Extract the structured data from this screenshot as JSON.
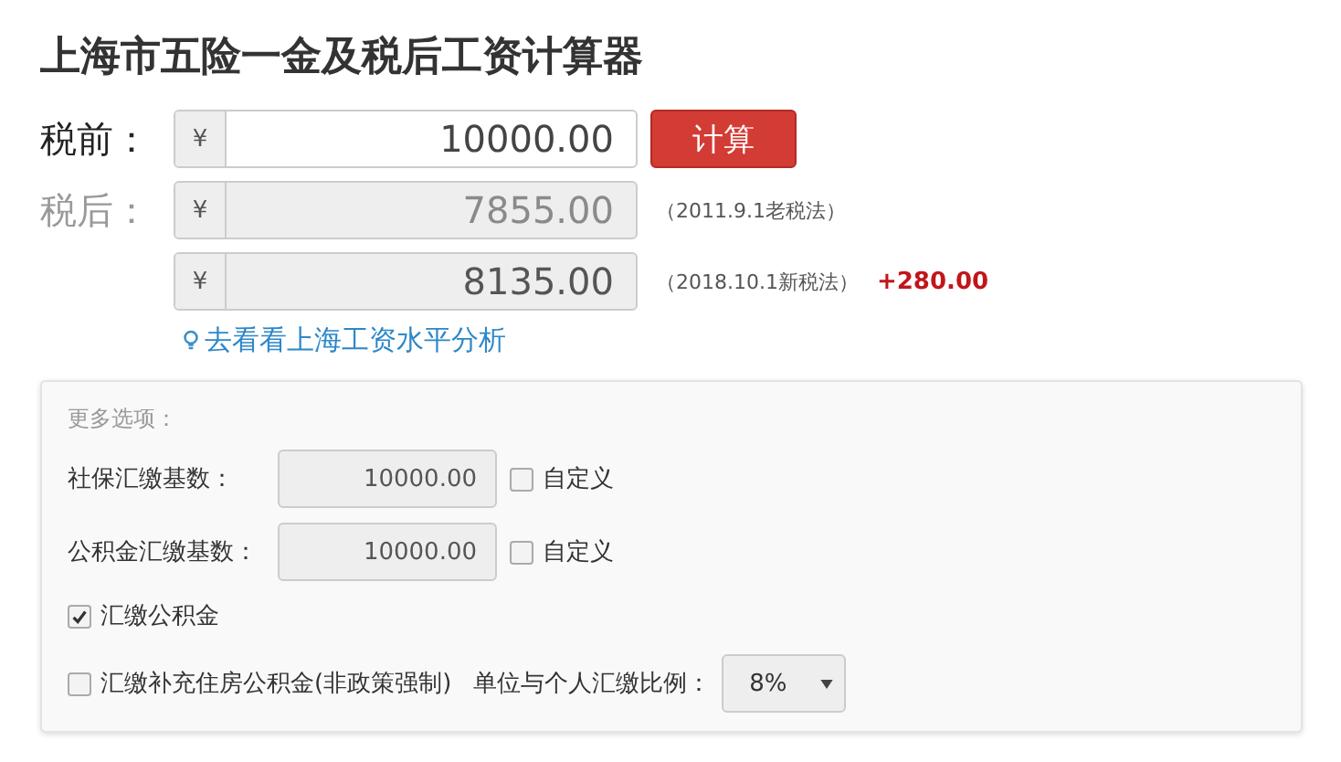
{
  "title": "上海市五险一金及税后工资计算器",
  "pretax": {
    "label": "税前：",
    "currency": "¥",
    "value": "10000.00"
  },
  "calc_button": "计算",
  "results_label": "税后：",
  "results": [
    {
      "currency": "¥",
      "value": "7855.00",
      "note": "（2011.9.1老税法）"
    },
    {
      "currency": "¥",
      "value": "8135.00",
      "note": "（2018.10.1新税法）",
      "diff": "+280.00"
    }
  ],
  "link": "去看看上海工资水平分析",
  "options": {
    "heading": "更多选项：",
    "bases": [
      {
        "label": "社保汇缴基数：",
        "value": "10000.00",
        "custom_label": "自定义",
        "checked": false
      },
      {
        "label": "公积金汇缴基数：",
        "value": "10000.00",
        "custom_label": "自定义",
        "checked": false
      }
    ],
    "checks": [
      {
        "label": "汇缴公积金",
        "checked": true
      },
      {
        "label": "汇缴补充住房公积金(非政策强制)",
        "checked": false
      }
    ],
    "ratio": {
      "label": "单位与个人汇缴比例：",
      "value": "8%"
    }
  }
}
